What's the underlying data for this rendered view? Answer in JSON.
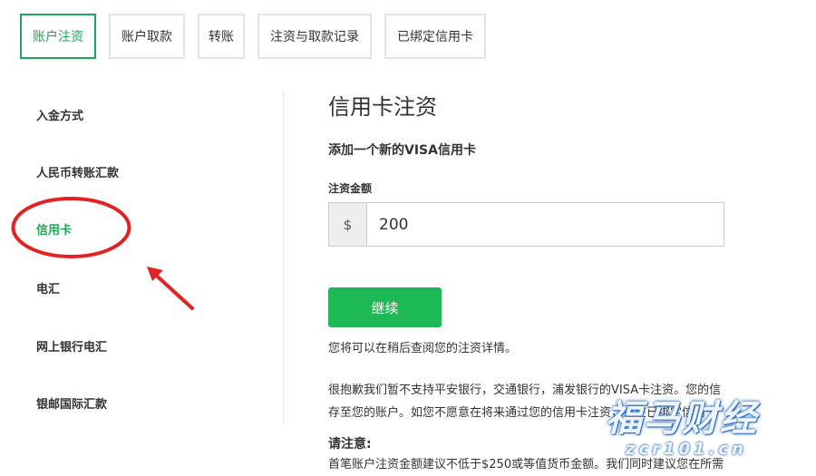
{
  "tabs": [
    {
      "label": "账户注资",
      "active": true
    },
    {
      "label": "账户取款",
      "active": false
    },
    {
      "label": "转账",
      "active": false
    },
    {
      "label": "注资与取款记录",
      "active": false
    },
    {
      "label": "已绑定信用卡",
      "active": false
    }
  ],
  "sidebar": {
    "items": [
      {
        "label": "入金方式",
        "active": false
      },
      {
        "label": "人民币转账汇款",
        "active": false
      },
      {
        "label": "信用卡",
        "active": true
      },
      {
        "label": "电汇",
        "active": false
      },
      {
        "label": "网上银行电汇",
        "active": false
      },
      {
        "label": "银邮国际汇款",
        "active": false
      }
    ]
  },
  "main": {
    "title": "信用卡注资",
    "subtitle": "添加一个新的VISA信用卡",
    "amount_label": "注资金额",
    "currency_symbol": "$",
    "amount_value": "200",
    "continue_label": "继续",
    "info_text": "您将可以在稍后查阅您的注资详情。",
    "notice_line1": "很抱歉我们暂不支持平安银行，交通银行，浦发银行的VISA卡注资。您的信",
    "notice_line2": "存至您的账户。如您不愿意在将来通过您的信用卡注资，请在已绑定信用卡",
    "notice_heading": "请注意:",
    "notice_line3": "首笔账户注资金额建议不低于$250或等值货币金额。我们同时建议您在所需"
  },
  "watermark": {
    "text": "福马财经",
    "url": "zcr101.cn"
  },
  "colors": {
    "accent": "#1aa855",
    "button": "#1db954",
    "annotation": "#e02424"
  }
}
